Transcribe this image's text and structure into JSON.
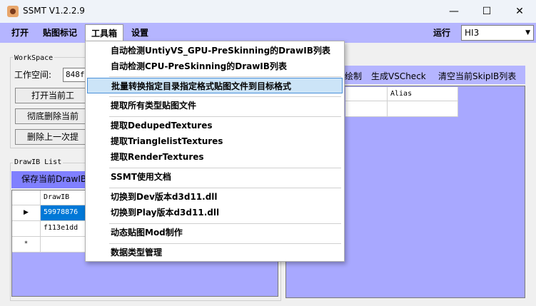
{
  "window": {
    "title": "SSMT V1.2.2.9",
    "minimize": "—",
    "maximize": "☐",
    "close": "✕"
  },
  "menubar": {
    "items": [
      "打开",
      "贴图标记",
      "工具箱",
      "设置"
    ],
    "run_label": "运行",
    "run_value": "HI3"
  },
  "workspace": {
    "group_title": "WorkSpace",
    "label": "工作空间:",
    "value": "848f1",
    "buttons": [
      "打开当前工",
      "彻底删除当前",
      "删除上一次提"
    ]
  },
  "drawib_list": {
    "group_title": "DrawIB List",
    "save_button": "保存当前DrawIB",
    "column_header": "DrawIB",
    "rows": [
      "59978876",
      "f113e1dd"
    ],
    "new_row_marker": "*"
  },
  "right_panel": {
    "toolbar": [
      "绘制",
      "生成VSCheck",
      "清空当前SkipIB列表"
    ],
    "columns": [
      "",
      "Alias"
    ]
  },
  "toolbox_menu": {
    "items": [
      "自动检测UntiyVS_GPU-PreSkinning的DrawIB列表",
      "自动检测CPU-PreSkinning的DrawIB列表",
      "批量转换指定目录指定格式贴图文件到目标格式",
      "提取所有类型贴图文件",
      "提取DedupedTextures",
      "提取TrianglelistTextures",
      "提取RenderTextures",
      "SSMT使用文档",
      "切换到Dev版本d3d11.dll",
      "切换到Play版本d3d11.dll",
      "动态贴图Mod制作",
      "数据类型管理"
    ]
  }
}
